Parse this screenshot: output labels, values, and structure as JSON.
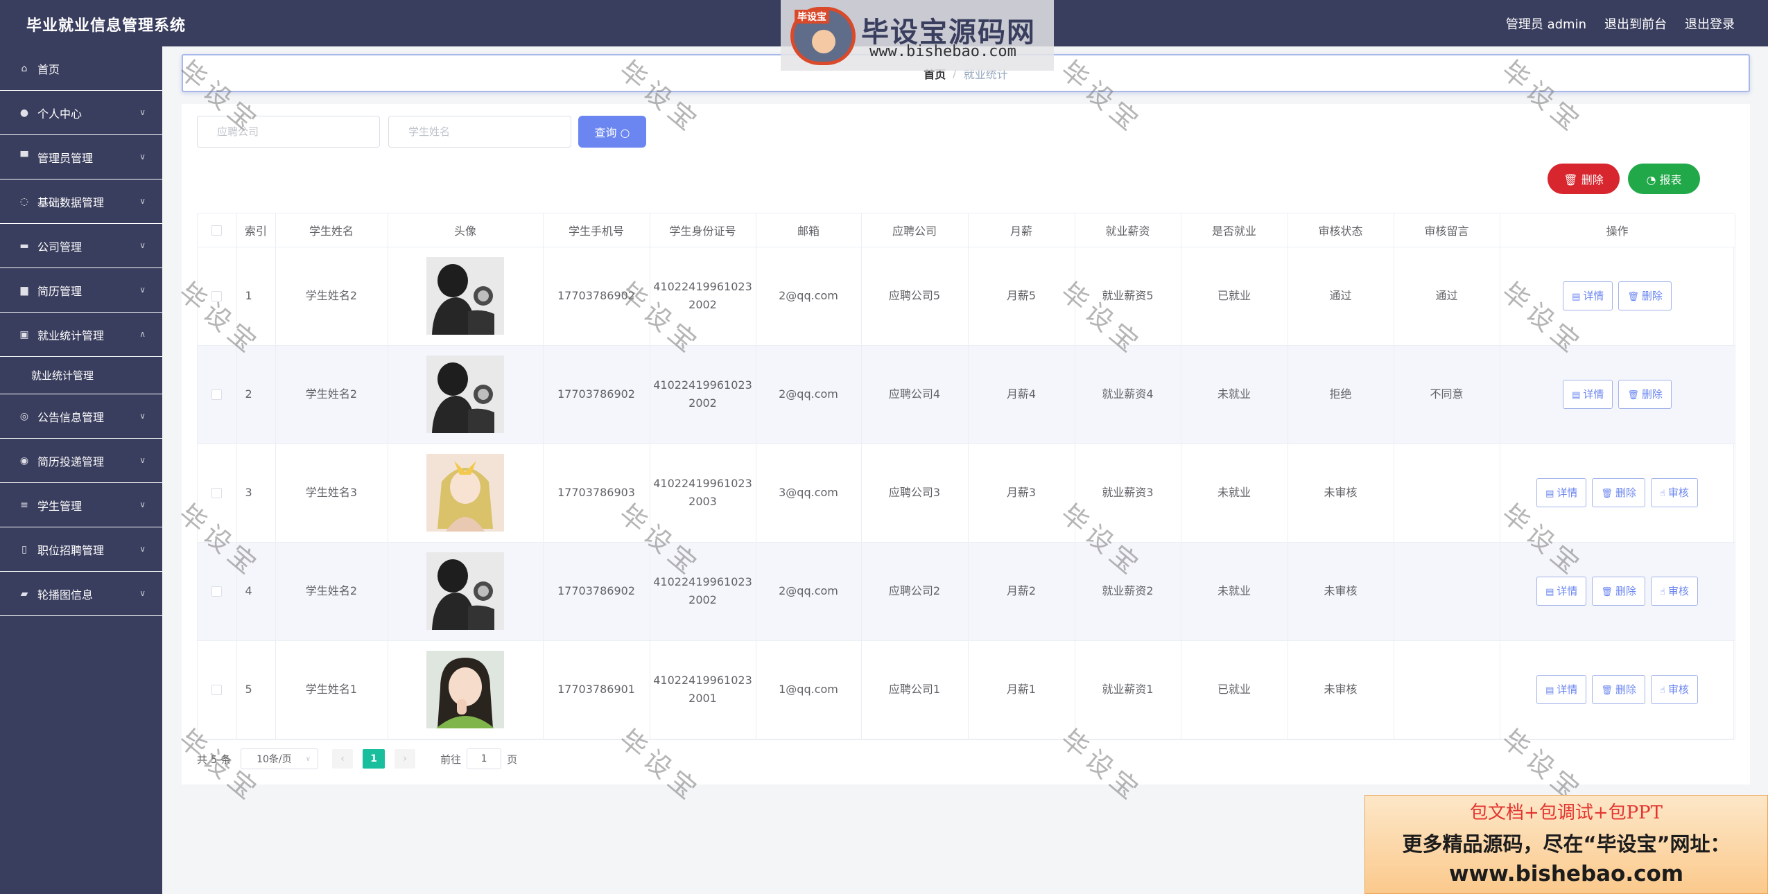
{
  "header": {
    "title": "毕业就业信息管理系统",
    "user": "管理员 admin",
    "front_link": "退出到前台",
    "logout": "退出登录"
  },
  "sidebar": {
    "items": [
      {
        "label": "首页",
        "icon": "home-icon",
        "glyph": "⌂"
      },
      {
        "label": "个人中心",
        "icon": "user-icon",
        "glyph": "●"
      },
      {
        "label": "管理员管理",
        "icon": "admin-icon",
        "glyph": "▀"
      },
      {
        "label": "基础数据管理",
        "icon": "bell-off-icon",
        "glyph": "◌"
      },
      {
        "label": "公司管理",
        "icon": "monitor-icon",
        "glyph": "▬"
      },
      {
        "label": "简历管理",
        "icon": "briefcase-icon",
        "glyph": "▆"
      },
      {
        "label": "就业统计管理",
        "icon": "checked-box-icon",
        "glyph": "▣"
      },
      {
        "label": "公告信息管理",
        "icon": "circle-icon",
        "glyph": "◎"
      },
      {
        "label": "简历投递管理",
        "icon": "info-icon",
        "glyph": "◉"
      },
      {
        "label": "学生管理",
        "icon": "list-icon",
        "glyph": "≡"
      },
      {
        "label": "职位招聘管理",
        "icon": "mic-icon",
        "glyph": "▯"
      },
      {
        "label": "轮播图信息",
        "icon": "film-icon",
        "glyph": "▰"
      }
    ],
    "sub_item": "就业统计管理"
  },
  "breadcrumb": {
    "home": "首页",
    "sep": "/",
    "current": "就业统计"
  },
  "search": {
    "company_placeholder": "应聘公司",
    "student_placeholder": "学生姓名",
    "query_label": "查询 ○"
  },
  "actions": {
    "delete_label": "🗑 删除",
    "report_label": "◔ 报表"
  },
  "table": {
    "headers": [
      "索引",
      "学生姓名",
      "头像",
      "学生手机号",
      "学生身份证号",
      "邮箱",
      "应聘公司",
      "月薪",
      "就业薪资",
      "是否就业",
      "审核状态",
      "审核留言",
      "操作"
    ],
    "rows": [
      {
        "index": "1",
        "name": "学生姓名2",
        "avatar": "portrait-dark",
        "phone": "17703786902",
        "id1": "41022419961023",
        "id2": "2002",
        "email": "2@qq.com",
        "company": "应聘公司5",
        "salary": "月薪5",
        "emp_salary": "就业薪资5",
        "employed": "已就业",
        "status": "通过",
        "message": "通过",
        "review": false
      },
      {
        "index": "2",
        "name": "学生姓名2",
        "avatar": "portrait-dark",
        "phone": "17703786902",
        "id1": "41022419961023",
        "id2": "2002",
        "email": "2@qq.com",
        "company": "应聘公司4",
        "salary": "月薪4",
        "emp_salary": "就业薪资4",
        "employed": "未就业",
        "status": "拒绝",
        "message": "不同意",
        "review": false
      },
      {
        "index": "3",
        "name": "学生姓名3",
        "avatar": "portrait-anime",
        "phone": "17703786903",
        "id1": "41022419961023",
        "id2": "2003",
        "email": "3@qq.com",
        "company": "应聘公司3",
        "salary": "月薪3",
        "emp_salary": "就业薪资3",
        "employed": "未就业",
        "status": "未审核",
        "message": "",
        "review": true
      },
      {
        "index": "4",
        "name": "学生姓名2",
        "avatar": "portrait-dark",
        "phone": "17703786902",
        "id1": "41022419961023",
        "id2": "2002",
        "email": "2@qq.com",
        "company": "应聘公司2",
        "salary": "月薪2",
        "emp_salary": "就业薪资2",
        "employed": "未就业",
        "status": "未审核",
        "message": "",
        "review": true
      },
      {
        "index": "5",
        "name": "学生姓名1",
        "avatar": "portrait-girl",
        "phone": "17703786901",
        "id1": "41022419961023",
        "id2": "2001",
        "email": "1@qq.com",
        "company": "应聘公司1",
        "salary": "月薪1",
        "emp_salary": "就业薪资1",
        "employed": "已就业",
        "status": "未审核",
        "message": "",
        "review": true
      }
    ],
    "detail_label": "详情",
    "delete_label": "删除",
    "review_label": "审核"
  },
  "pagination": {
    "total": "共 5 条",
    "page_size": "10条/页",
    "current_page": "1",
    "goto_prefix": "前往",
    "goto_value": "1",
    "goto_suffix": "页"
  },
  "watermark": {
    "logo_title": "毕设宝源码网",
    "logo_url": "www.bishebao.com",
    "logo_badge": "毕设宝",
    "text": "毕设宝"
  },
  "ad": {
    "line1": "包文档+包调试+包PPT",
    "line2": "更多精品源码，尽在“毕设宝”网址：",
    "line3": "www.bishebao.com"
  },
  "colors": {
    "sidebar_bg": "#3a3e5e",
    "primary": "#6b86f0",
    "danger": "#d7262e",
    "success": "#21a848",
    "pager_active": "#19be9c"
  }
}
